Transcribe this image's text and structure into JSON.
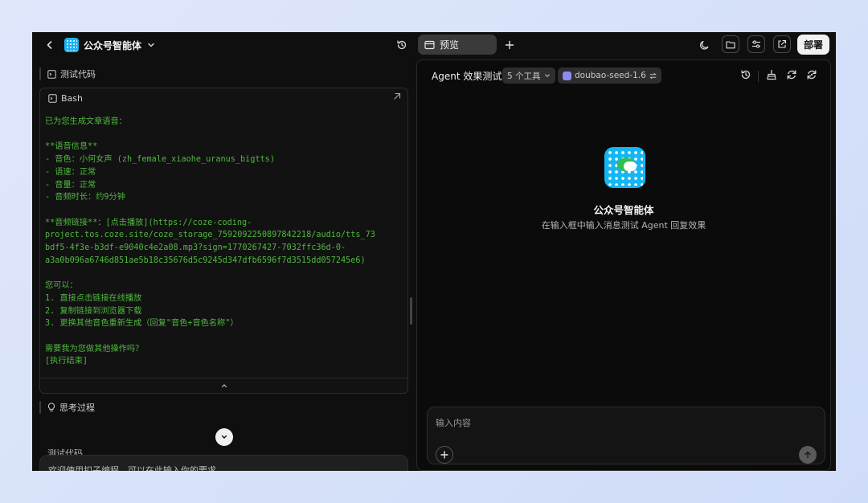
{
  "header": {
    "app_title": "公众号智能体",
    "preview_tab": "预览",
    "deploy_label": "部署"
  },
  "left": {
    "section_test_code": "测试代码",
    "bash_label": "Bash",
    "bash_output": "已为您生成文章语音：\n\n**语音信息**\n- 音色：小何女声 (zh_female_xiaohe_uranus_bigtts)\n- 语速：正常\n- 音量：正常\n- 音频时长：约9分钟\n\n**音频链接**：[点击播放](https://coze-coding-\nproject.tos.coze.site/coze_storage_7592092250897842218/audio/tts_73\nbdf5-4f3e-b3df-e9040c4e2a08.mp3?sign=1770267427-7032ffc36d-0-\na3a0b096a6746d851ae5b18c35676d5c9245d347dfb6596f7d3515dd057245e6)\n\n您可以：\n1. 直接点击链接在线播放\n2. 复制链接到浏览器下载\n3. 更换其他音色重新生成（回复\"音色+音色名称\"）\n\n需要我为您做其他操作吗？\n[执行结束]",
    "section_thinking": "思考过程",
    "section_test_code_2": "测试代码",
    "chat_placeholder": "欢迎使用扣子编程，可以在此输入你的要求。"
  },
  "right": {
    "agent_title": "Agent 效果测试",
    "tools_chip": "5 个工具",
    "model_chip": "doubao-seed-1.6",
    "agent_name": "公众号智能体",
    "agent_hint": "在输入框中输入消息测试 Agent 回复效果",
    "input_placeholder": "输入内容"
  },
  "icons": {
    "back": "chevron-left-icon",
    "dropdown": "chevron-down-icon",
    "history": "history-icon",
    "preview": "window-icon",
    "add_tab": "plus-icon",
    "theme": "moon-icon",
    "folder": "folder-icon",
    "settings": "sliders-icon",
    "open_external": "external-link-icon"
  },
  "colors": {
    "window_bg": "#0f0f0f",
    "terminal_text": "#4fb83f",
    "logo_blue": "#14b6f4"
  }
}
